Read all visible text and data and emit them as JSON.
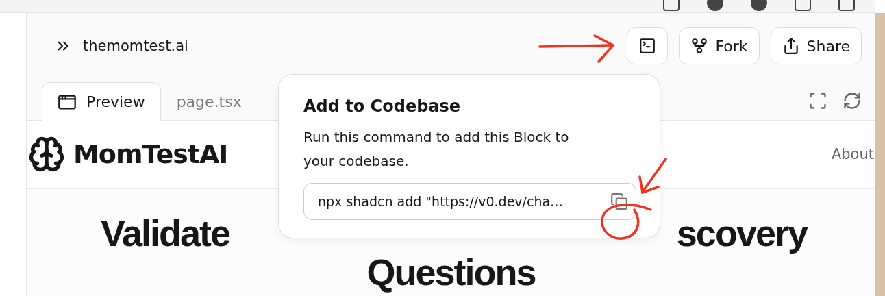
{
  "header": {
    "title": "themomtest.ai",
    "buttons": [
      {
        "kind": "terminal"
      },
      {
        "kind": "fork",
        "label": "Fork"
      },
      {
        "kind": "share",
        "label": "Share"
      }
    ]
  },
  "tabs": [
    {
      "label": "Preview",
      "selected": true
    },
    {
      "label": "page.tsx",
      "selected": false
    }
  ],
  "preview": {
    "brand": "MomTestAI",
    "nav_link": "About",
    "headline_left": "Validate",
    "headline_right": "scovery",
    "headline_line2": "Questions"
  },
  "popover": {
    "title": "Add to Codebase",
    "description": "Run this command to add this Block to your codebase.",
    "command": "npx shadcn add \"https://v0.dev/cha…"
  }
}
